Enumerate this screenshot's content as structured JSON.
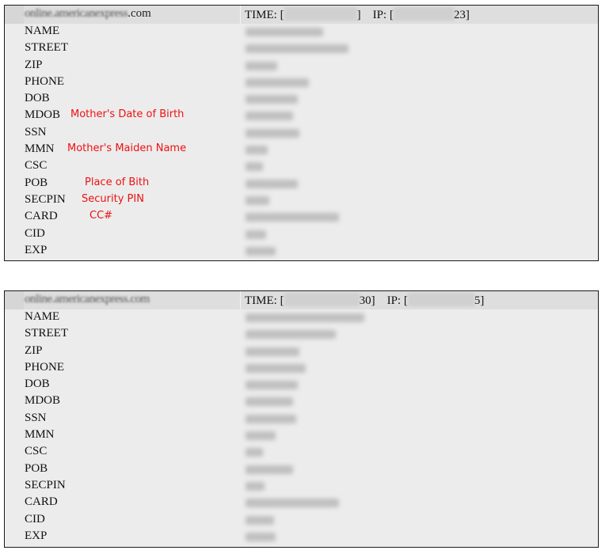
{
  "annotation_color": "#ee1111",
  "records": [
    {
      "domain_prefix": "online.americanexpress",
      "domain_suffix": ".com",
      "time_label": "TIME:",
      "time_visible_suffix": "",
      "ip_label": "IP:",
      "ip_visible_suffix": "23",
      "fields": [
        {
          "label": "NAME",
          "annotation": ""
        },
        {
          "label": "STREET",
          "annotation": ""
        },
        {
          "label": "ZIP",
          "annotation": ""
        },
        {
          "label": "PHONE",
          "annotation": ""
        },
        {
          "label": "DOB",
          "annotation": ""
        },
        {
          "label": "MDOB",
          "annotation": "Mother's Date of Birth"
        },
        {
          "label": "SSN",
          "annotation": ""
        },
        {
          "label": "MMN",
          "annotation": "Mother's Maiden Name"
        },
        {
          "label": "CSC",
          "annotation": ""
        },
        {
          "label": "POB",
          "annotation": "Place of Bith"
        },
        {
          "label": "SECPIN",
          "annotation": "Security PIN"
        },
        {
          "label": "CARD",
          "annotation": "CC#"
        },
        {
          "label": "CID",
          "annotation": ""
        },
        {
          "label": "EXP",
          "annotation": ""
        }
      ],
      "values_redacted": true
    },
    {
      "domain_prefix": "online.americanexpress.com",
      "domain_suffix": "",
      "time_label": "TIME:",
      "time_visible_suffix": "30",
      "ip_label": "IP:",
      "ip_visible_suffix": "5",
      "fields": [
        {
          "label": "NAME",
          "annotation": ""
        },
        {
          "label": "STREET",
          "annotation": ""
        },
        {
          "label": "ZIP",
          "annotation": ""
        },
        {
          "label": "PHONE",
          "annotation": ""
        },
        {
          "label": "DOB",
          "annotation": ""
        },
        {
          "label": "MDOB",
          "annotation": ""
        },
        {
          "label": "SSN",
          "annotation": ""
        },
        {
          "label": "MMN",
          "annotation": ""
        },
        {
          "label": "CSC",
          "annotation": ""
        },
        {
          "label": "POB",
          "annotation": ""
        },
        {
          "label": "SECPIN",
          "annotation": ""
        },
        {
          "label": "CARD",
          "annotation": ""
        },
        {
          "label": "CID",
          "annotation": ""
        },
        {
          "label": "EXP",
          "annotation": ""
        }
      ],
      "values_redacted": true
    }
  ]
}
